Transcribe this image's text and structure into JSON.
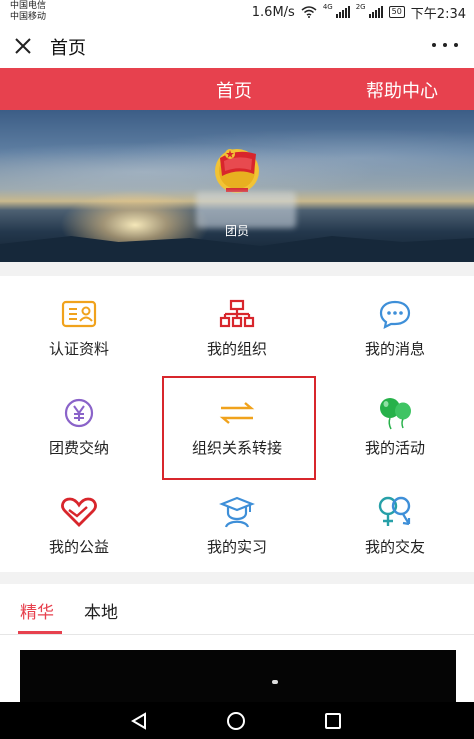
{
  "status_bar": {
    "carrier_1": "中国电信",
    "carrier_2": "中国移动",
    "speed": "1.6M/s",
    "net_1": "4G",
    "net_2": "2G",
    "battery": "50",
    "time": "下午2:34"
  },
  "title_bar": {
    "title": "首页",
    "close_icon": "close-icon",
    "more_icon": "more-icon"
  },
  "nav": {
    "home": "首页",
    "help": "帮助中心"
  },
  "banner": {
    "role": "团员",
    "emblem_icon": "league-emblem-icon"
  },
  "grid": [
    {
      "label": "认证资料",
      "icon": "id-card-icon",
      "color": "#f0a21c"
    },
    {
      "label": "我的组织",
      "icon": "org-chart-icon",
      "color": "#d8262c"
    },
    {
      "label": "我的消息",
      "icon": "message-icon",
      "color": "#3e8fd8"
    },
    {
      "label": "团费交纳",
      "icon": "yuan-coin-icon",
      "color": "#8a63c9"
    },
    {
      "label": "组织关系转接",
      "icon": "transfer-arrows-icon",
      "color": "#f0a21c"
    },
    {
      "label": "我的活动",
      "icon": "balloons-icon",
      "color": "#27b14a"
    },
    {
      "label": "我的公益",
      "icon": "heart-hand-icon",
      "color": "#d8262c"
    },
    {
      "label": "我的实习",
      "icon": "graduate-icon",
      "color": "#3e8fd8"
    },
    {
      "label": "我的交友",
      "icon": "friends-icon",
      "color": "#27a0a8"
    }
  ],
  "tabs": [
    {
      "label": "精华",
      "active": true
    },
    {
      "label": "本地",
      "active": false
    }
  ],
  "colors": {
    "brand_red": "#e7414e",
    "highlight_border": "#d8262c"
  }
}
